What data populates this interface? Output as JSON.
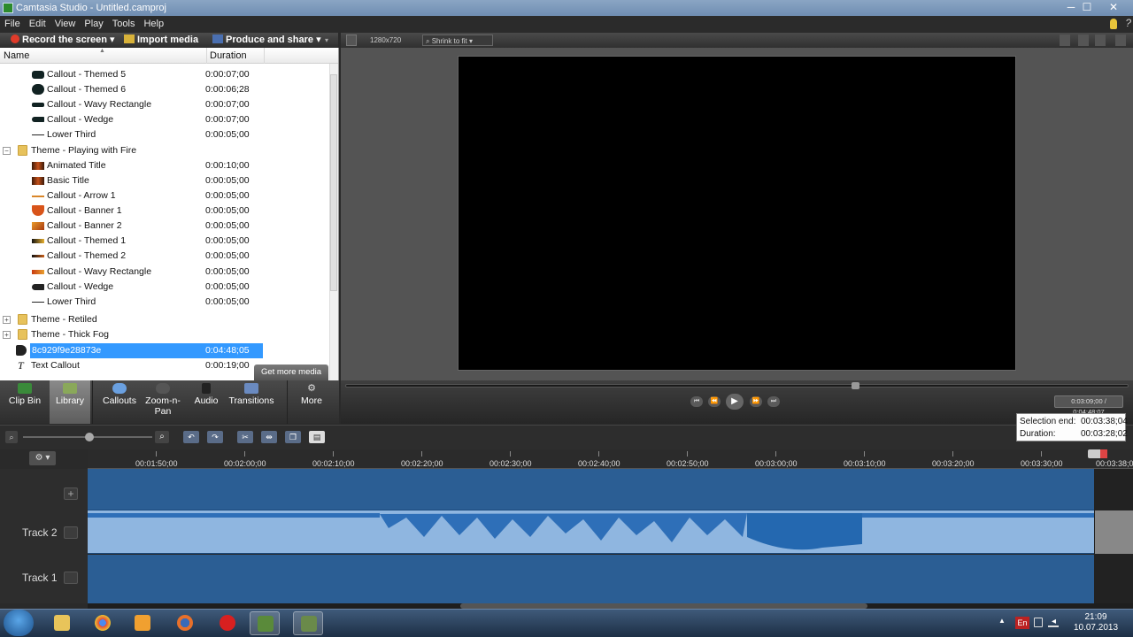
{
  "window": {
    "title": "Camtasia Studio - Untitled.camproj",
    "min": "─",
    "max": "☐",
    "close": "✕"
  },
  "menu": [
    "File",
    "Edit",
    "View",
    "Play",
    "Tools",
    "Help"
  ],
  "actions": {
    "record": "Record the screen",
    "import": "Import media",
    "produce": "Produce and share"
  },
  "preview_toolbar": {
    "dimensions": "1280x720",
    "zoom": "Shrink to fit"
  },
  "list": {
    "col_name": "Name",
    "col_duration": "Duration",
    "rows": [
      {
        "name": "Callout - Themed 5",
        "duration": "0:00:07;00",
        "icon": "callout-themed-icon"
      },
      {
        "name": "Callout - Themed 6",
        "duration": "0:00:06;28",
        "icon": "callout-themed-icon"
      },
      {
        "name": "Callout - Wavy Rectangle",
        "duration": "0:00:07;00",
        "icon": "wavy-rectangle-icon"
      },
      {
        "name": "Callout - Wedge",
        "duration": "0:00:07;00",
        "icon": "wedge-icon"
      },
      {
        "name": "Lower Third",
        "duration": "0:00:05;00",
        "icon": "lower-third-icon"
      },
      {
        "name": "Theme - Playing with Fire",
        "duration": "",
        "icon": "folder-icon"
      },
      {
        "name": "Animated Title",
        "duration": "0:00:10;00",
        "icon": "fire-title-icon"
      },
      {
        "name": "Basic Title",
        "duration": "0:00:05;00",
        "icon": "fire-title-icon"
      },
      {
        "name": "Callout - Arrow 1",
        "duration": "0:00:05;00",
        "icon": "arrow-icon"
      },
      {
        "name": "Callout - Banner 1",
        "duration": "0:00:05;00",
        "icon": "banner-icon"
      },
      {
        "name": "Callout - Banner 2",
        "duration": "0:00:05;00",
        "icon": "banner-icon"
      },
      {
        "name": "Callout - Themed 1",
        "duration": "0:00:05;00",
        "icon": "callout-themed-icon"
      },
      {
        "name": "Callout - Themed 2",
        "duration": "0:00:05;00",
        "icon": "callout-themed-icon"
      },
      {
        "name": "Callout - Wavy Rectangle",
        "duration": "0:00:05;00",
        "icon": "wavy-rectangle-icon"
      },
      {
        "name": "Callout - Wedge",
        "duration": "0:00:05;00",
        "icon": "wedge-icon"
      },
      {
        "name": "Lower Third",
        "duration": "0:00:05;00",
        "icon": "lower-third-icon"
      },
      {
        "name": "Theme - Retiled",
        "duration": "",
        "icon": "folder-icon"
      },
      {
        "name": "Theme - Thick Fog",
        "duration": "",
        "icon": "folder-icon"
      },
      {
        "name": "8c929f9e28873e",
        "duration": "0:04:48;05",
        "icon": "audio-icon"
      },
      {
        "name": "Text Callout",
        "duration": "0:00:19;00",
        "icon": "text-icon"
      }
    ],
    "get_more": "Get more media"
  },
  "tabs": [
    {
      "label": "Clip Bin"
    },
    {
      "label": "Library"
    },
    {
      "label": "Callouts"
    },
    {
      "label": "Zoom-n-Pan"
    },
    {
      "label": "Audio"
    },
    {
      "label": "Transitions"
    },
    {
      "label": "More"
    }
  ],
  "transport": {
    "timecode": "0:03:09;00 / 0:04:48;07"
  },
  "selection": {
    "end_label": "Selection end:",
    "end_value": "00:03:38;04",
    "duration_label": "Duration:",
    "duration_value": "00:03:28;02"
  },
  "ruler": [
    "00:01:50;00",
    "00:02:00;00",
    "00:02:10;00",
    "00:02:20;00",
    "00:02:30;00",
    "00:02:40;00",
    "00:02:50;00",
    "00:03:00;00",
    "00:03:10;00",
    "00:03:20;00",
    "00:03:30;00",
    "00:03:38;0"
  ],
  "tracks": {
    "track2": "Track 2",
    "track1": "Track 1"
  },
  "taskbar": {
    "lang": "En",
    "time": "21:09",
    "date": "10.07.2013"
  }
}
